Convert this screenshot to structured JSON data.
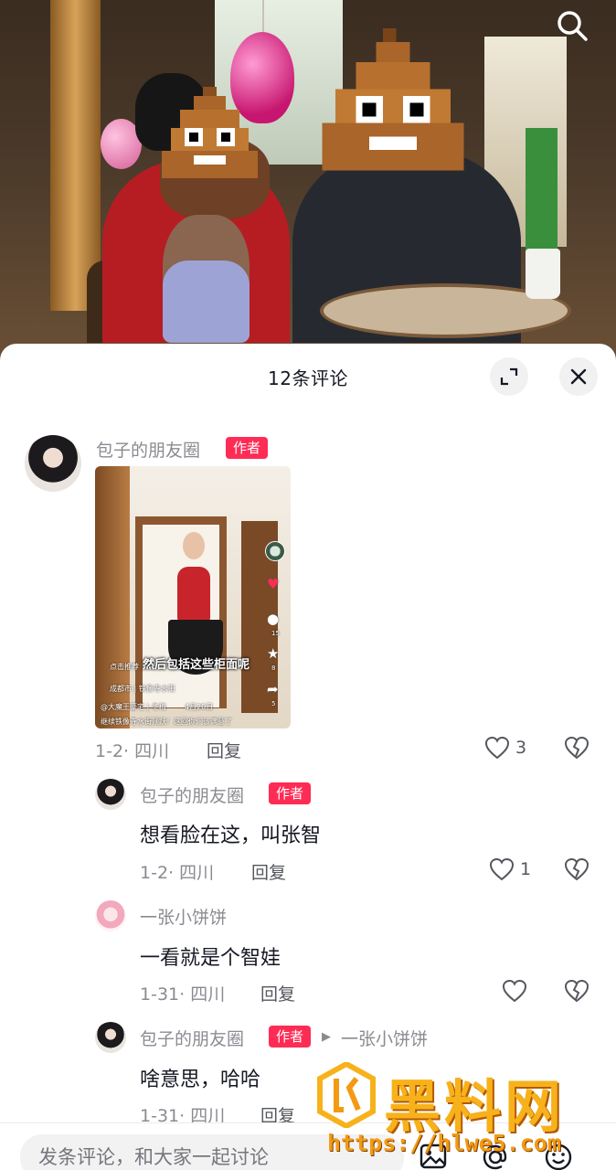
{
  "video": {
    "search_icon": "search-icon"
  },
  "comments_header": {
    "title": "12条评论",
    "expand_icon": "expand-icon",
    "close_icon": "close-icon"
  },
  "comments": [
    {
      "username": "包子的朋友圈",
      "badge": "作者",
      "attachment": {
        "caption": "然后包括这些柜面呢",
        "tip": "点击推荐",
        "location": "成都市 | 铁像寺水街",
        "author": "@大魔王豪宅 | 冬梅",
        "date": "4月20日",
        "desc": "继续铁像寺水街顶跃！这回你们该满意了",
        "side_counts": [
          "15",
          "8",
          "5"
        ]
      },
      "meta": "1-2· 四川",
      "reply_label": "回复",
      "likes": "3"
    },
    {
      "username": "包子的朋友圈",
      "badge": "作者",
      "text": "想看脸在这，叫张智",
      "meta": "1-2· 四川",
      "reply_label": "回复",
      "likes": "1"
    },
    {
      "username": "一张小饼饼",
      "text": "一看就是个智娃",
      "meta": "1-31· 四川",
      "reply_label": "回复",
      "likes": ""
    },
    {
      "username": "包子的朋友圈",
      "badge": "作者",
      "reply_to": "一张小饼饼",
      "text": "啥意思，哈哈",
      "meta": "1-31· 四川",
      "reply_label": "回复"
    }
  ],
  "input_bar": {
    "placeholder": "发条评论，和大家一起讨论",
    "icons": [
      "image-icon",
      "at-icon",
      "emoji-icon"
    ]
  },
  "watermark": {
    "logo_text": "黑料网",
    "url": "https://hlwe5.com"
  },
  "colors": {
    "badge": "#fe2c55",
    "watermark": "#f7b21b"
  }
}
